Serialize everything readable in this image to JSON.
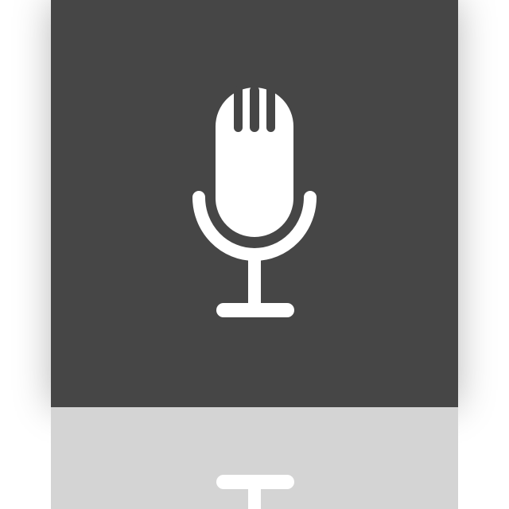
{
  "icon": {
    "name": "microphone-icon",
    "tile_color": "#464646",
    "glyph_color": "#ffffff",
    "reflection_tile_color": "#d4d4d4",
    "reflection_glyph_color": "#ffffff"
  }
}
